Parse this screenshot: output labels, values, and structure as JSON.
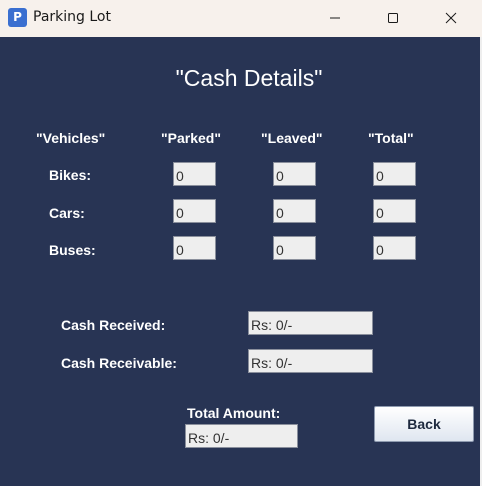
{
  "window": {
    "title": "Parking Lot",
    "icon_glyph": "P",
    "controls": [
      "minimize-icon",
      "maximize-icon",
      "close-icon"
    ]
  },
  "heading": "\"Cash Details\"",
  "columns": {
    "vehicles": "\"Vehicles\"",
    "parked": "\"Parked\"",
    "leaved": "\"Leaved\"",
    "total": "\"Total\""
  },
  "rows": [
    {
      "label": "Bikes:",
      "parked": "0",
      "leaved": "0",
      "total": "0"
    },
    {
      "label": "Cars:",
      "parked": "0",
      "leaved": "0",
      "total": "0"
    },
    {
      "label": "Buses:",
      "parked": "0",
      "leaved": "0",
      "total": "0"
    }
  ],
  "cash": {
    "received_label": "Cash Received:",
    "received_value": "Rs: 0/-",
    "receivable_label": "Cash Receivable:",
    "receivable_value": "Rs: 0/-",
    "total_label": "Total Amount:",
    "total_value": "Rs: 0/-"
  },
  "back_label": "Back",
  "colors": {
    "background": "#283454",
    "titlebar": "#f7f1ec",
    "field_background": "#eeeeee",
    "text": "#ffffff"
  }
}
